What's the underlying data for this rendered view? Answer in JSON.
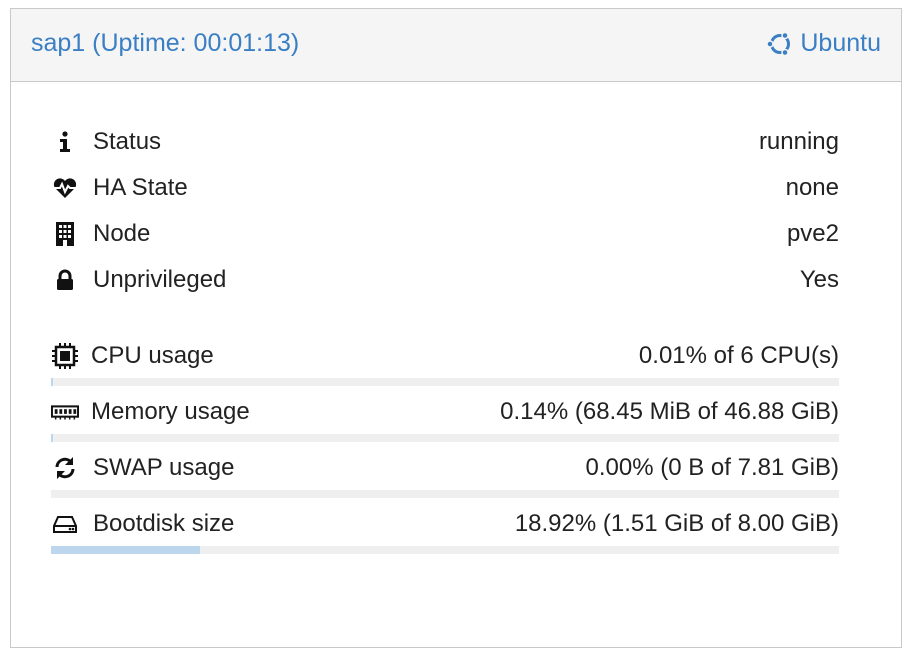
{
  "header": {
    "title": "sap1 (Uptime: 00:01:13)",
    "os_label": "Ubuntu",
    "os_icon": "ubuntu-icon"
  },
  "info_rows": [
    {
      "icon": "info-icon",
      "label": "Status",
      "value": "running"
    },
    {
      "icon": "heartbeat-icon",
      "label": "HA State",
      "value": "none"
    },
    {
      "icon": "building-icon",
      "label": "Node",
      "value": "pve2"
    },
    {
      "icon": "lock-icon",
      "label": "Unprivileged",
      "value": "Yes"
    }
  ],
  "usage_rows": [
    {
      "icon": "cpu-icon",
      "label": "CPU usage",
      "value": "0.01% of 6 CPU(s)",
      "fraction": 0.0001
    },
    {
      "icon": "memory-icon",
      "label": "Memory usage",
      "value": "0.14% (68.45 MiB of 46.88 GiB)",
      "fraction": 0.0014
    },
    {
      "icon": "refresh-icon",
      "label": "SWAP usage",
      "value": "0.00% (0 B of 7.81 GiB)",
      "fraction": 0.0
    },
    {
      "icon": "harddisk-icon",
      "label": "Bootdisk size",
      "value": "18.92% (1.51 GiB of 8.00 GiB)",
      "fraction": 0.1892
    }
  ],
  "colors": {
    "accent": "#3a7fc4",
    "bar_fill": "#bcd6ee",
    "bar_track": "#efefef"
  }
}
